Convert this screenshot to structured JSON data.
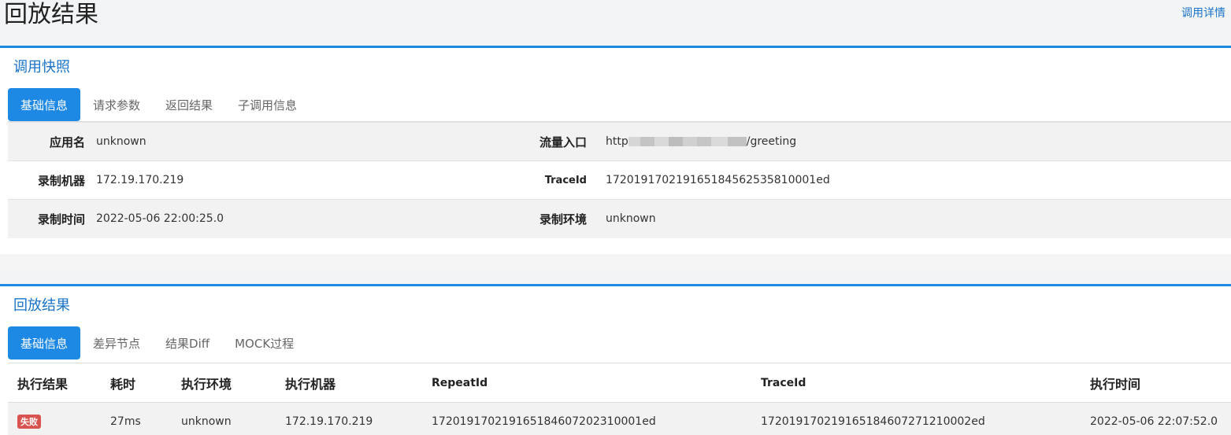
{
  "header": {
    "title": "回放结果",
    "link": "调用详情"
  },
  "snapshot": {
    "title": "调用快照",
    "tabs": [
      "基础信息",
      "请求参数",
      "返回结果",
      "子调用信息"
    ],
    "rows": [
      {
        "l1": "应用名",
        "v1": "unknown",
        "l2": "流量入口",
        "v2_prefix": "http",
        "v2_suffix": "/greeting"
      },
      {
        "l1": "录制机器",
        "v1": "172.19.170.219",
        "l2": "TraceId",
        "v2": "172019170219165184562535810001ed"
      },
      {
        "l1": "录制时间",
        "v1": "2022-05-06 22:00:25.0",
        "l2": "录制环境",
        "v2": "unknown"
      }
    ]
  },
  "replay": {
    "title": "回放结果",
    "tabs": [
      "基础信息",
      "差异节点",
      "结果Diff",
      "MOCK过程"
    ],
    "columns": [
      "执行结果",
      "耗时",
      "执行环境",
      "执行机器",
      "RepeatId",
      "TraceId",
      "执行时间"
    ],
    "row": {
      "status": "失败",
      "cost": "27ms",
      "env": "unknown",
      "host": "172.19.170.219",
      "repeat_id": "172019170219165184607202310001ed",
      "trace_id": "172019170219165184607271210002ed",
      "time": "2022-05-06 22:07:52.0"
    }
  },
  "colors": {
    "accent": "#1e88e5",
    "link": "#1a73c8",
    "danger": "#d9534f"
  }
}
